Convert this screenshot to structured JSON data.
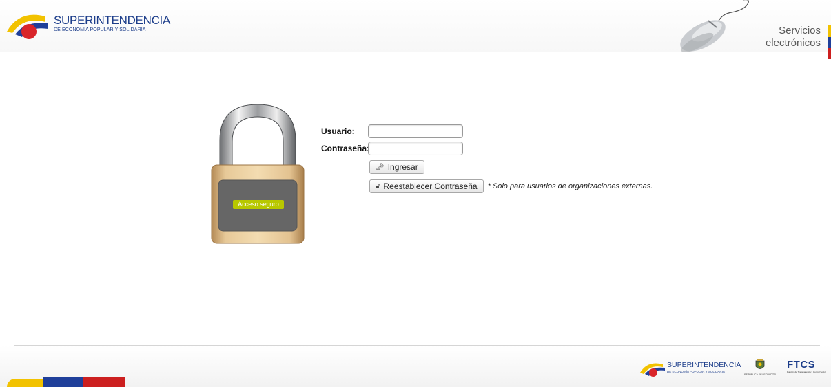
{
  "header": {
    "brand_main": "SUPERINTENDENCIA",
    "brand_sub": "DE ECONOMÍA POPULAR Y SOLIDARIA",
    "services_line1": "Servicios",
    "services_line2": "electrónicos"
  },
  "lock": {
    "badge_label": "Acceso seguro"
  },
  "form": {
    "user_label": "Usuario:",
    "user_value": "",
    "password_label": "Contraseña:",
    "password_value": "",
    "login_button": "Ingresar",
    "reset_button": "Reestablecer Contraseña",
    "reset_note": "* Solo para usuarios de organizaciones externas."
  },
  "footer": {
    "brand_main": "SUPERINTENDENCIA",
    "brand_sub": "DE ECONOMÍA POPULAR Y SOLIDARIA",
    "seal_text": "REPÚBLICA DEL ECUADOR",
    "ftcs_main": "FTCS",
    "ftcs_sub": "Función de Transparencia y Control Social"
  },
  "colors": {
    "brand_blue": "#1c3d8a",
    "flag_yellow": "#f2c200",
    "flag_blue": "#1f3f9a",
    "flag_red": "#cc1f1f",
    "badge_green": "#b8c800"
  },
  "icons": {
    "login_icon": "key-icon",
    "reset_icon": "unlock-icon"
  }
}
